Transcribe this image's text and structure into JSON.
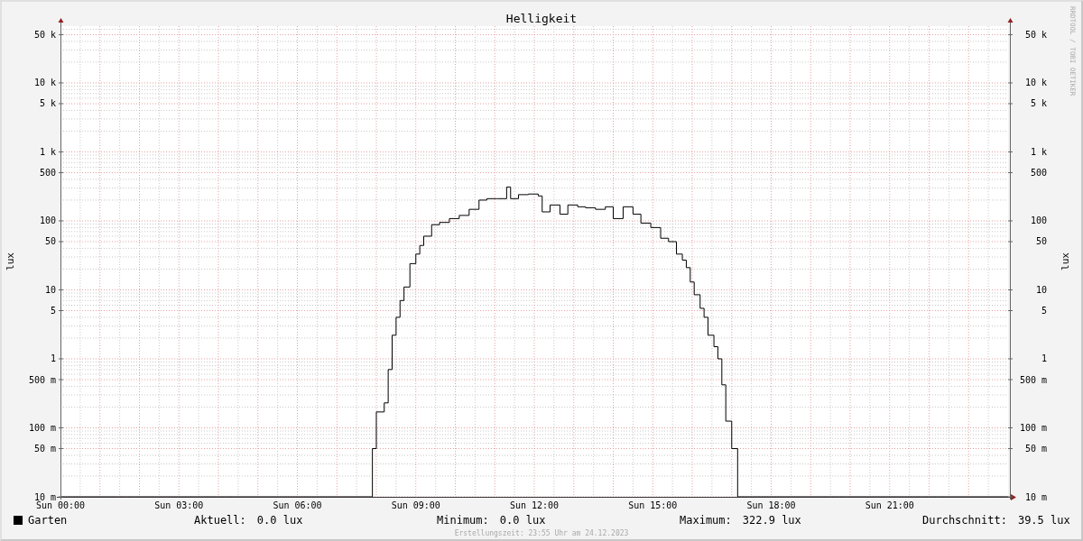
{
  "chart": {
    "title": "Helligkeit",
    "side_label": "RRDTOOL / TOBI OETIKER",
    "left_axis_title": "lux",
    "right_axis_title": "lux",
    "left_axis_labels": [
      "50 k",
      "10 k",
      "5 k",
      "1 k",
      "500",
      "100",
      "50",
      "10",
      "5",
      "1",
      "500 m",
      "100 m",
      "50 m",
      "10 m"
    ],
    "right_axis_labels": [
      "50 k",
      "10 k",
      "5 k",
      "1 k",
      "500",
      "100",
      "50",
      "10",
      "5",
      "1",
      "500 m",
      "100 m",
      "50 m",
      "10 m"
    ],
    "x_axis_labels": [
      "Sun 00:00",
      "Sun 03:00",
      "Sun 06:00",
      "Sun 09:00",
      "Sun 12:00",
      "Sun 15:00",
      "Sun 18:00",
      "Sun 21:00"
    ],
    "series": {
      "name": "Garten",
      "color": "#000000"
    }
  },
  "legend": {
    "stats": [
      {
        "label": "Aktuell:",
        "value": "0.0 lux"
      },
      {
        "label": "Minimum:",
        "value": "0.0 lux"
      },
      {
        "label": "Maximum:",
        "value": "322.9 lux"
      },
      {
        "label": "Durchschnitt:",
        "value": "39.5 lux"
      }
    ]
  },
  "footer": "Erstellungszeit: 23:55 Uhr am 24.12.2023"
}
